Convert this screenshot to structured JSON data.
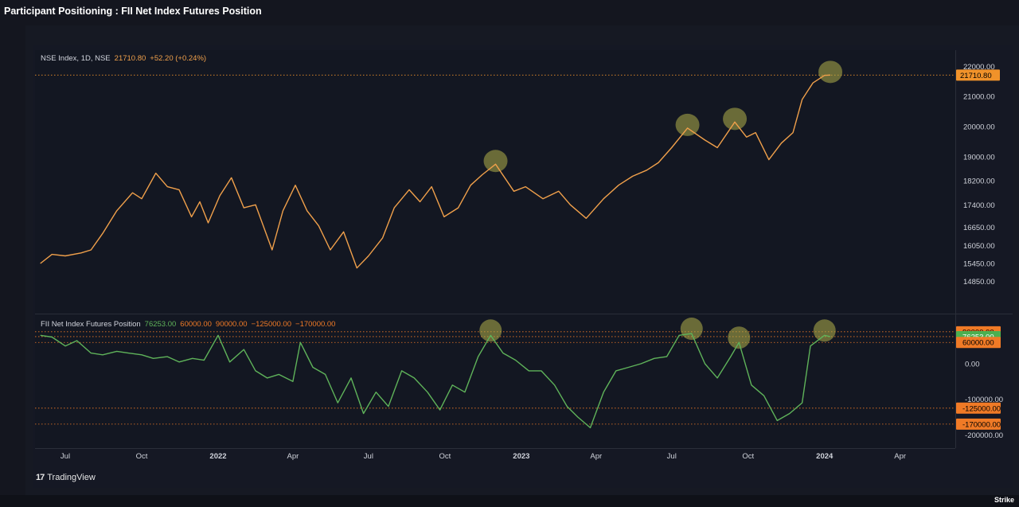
{
  "page": {
    "title": "Participant Positioning : FII Net Index Futures Position",
    "footer_brand": "TradingView",
    "corner_mark": "Strike"
  },
  "colors": {
    "nifty_line": "#f0a04b",
    "fii_line": "#5fb35a",
    "highlight": "#b3b04a",
    "price_tag": "#f0922a",
    "fii_tag": "#4caf50",
    "level_tag": "#f07a26",
    "background": "#131722",
    "text": "#d1d4dc",
    "muted": "#a3a6af"
  },
  "chart_data": [
    {
      "type": "line",
      "legend": {
        "symbol": "NSE Index, 1D, NSE",
        "last": "21710.80",
        "change": "+52.20 (+0.24%)"
      },
      "y_ticks": [
        "22000.00",
        "21000.00",
        "20000.00",
        "19000.00",
        "18200.00",
        "17400.00",
        "16650.00",
        "16050.00",
        "15450.00",
        "14850.00"
      ],
      "y_tick_values": [
        22000,
        21000,
        20000,
        19000,
        18200,
        17400,
        16650,
        16050,
        15450,
        14850
      ],
      "last_value_label": "21710.80",
      "last_value": 21710.8,
      "series": [
        {
          "values": [
            [
              "2021-06-01",
              15450
            ],
            [
              "2021-06-15",
              15750
            ],
            [
              "2021-07-01",
              15700
            ],
            [
              "2021-07-20",
              15800
            ],
            [
              "2021-08-01",
              15900
            ],
            [
              "2021-08-15",
              16450
            ],
            [
              "2021-09-01",
              17200
            ],
            [
              "2021-09-20",
              17800
            ],
            [
              "2021-10-01",
              17600
            ],
            [
              "2021-10-18",
              18450
            ],
            [
              "2021-11-01",
              18000
            ],
            [
              "2021-11-15",
              17900
            ],
            [
              "2021-11-30",
              17000
            ],
            [
              "2021-12-10",
              17500
            ],
            [
              "2021-12-20",
              16800
            ],
            [
              "2022-01-03",
              17700
            ],
            [
              "2022-01-17",
              18300
            ],
            [
              "2022-02-01",
              17300
            ],
            [
              "2022-02-15",
              17400
            ],
            [
              "2022-03-07",
              15900
            ],
            [
              "2022-03-20",
              17200
            ],
            [
              "2022-04-04",
              18050
            ],
            [
              "2022-04-18",
              17200
            ],
            [
              "2022-05-02",
              16700
            ],
            [
              "2022-05-16",
              15900
            ],
            [
              "2022-06-01",
              16500
            ],
            [
              "2022-06-17",
              15300
            ],
            [
              "2022-07-01",
              15700
            ],
            [
              "2022-07-18",
              16300
            ],
            [
              "2022-08-01",
              17300
            ],
            [
              "2022-08-19",
              17900
            ],
            [
              "2022-09-01",
              17500
            ],
            [
              "2022-09-15",
              18000
            ],
            [
              "2022-09-30",
              17000
            ],
            [
              "2022-10-17",
              17300
            ],
            [
              "2022-11-01",
              18050
            ],
            [
              "2022-11-15",
              18400
            ],
            [
              "2022-12-01",
              18750
            ],
            [
              "2022-12-23",
              17850
            ],
            [
              "2023-01-06",
              18000
            ],
            [
              "2023-01-27",
              17600
            ],
            [
              "2023-02-15",
              17850
            ],
            [
              "2023-03-01",
              17400
            ],
            [
              "2023-03-20",
              16950
            ],
            [
              "2023-04-10",
              17600
            ],
            [
              "2023-04-28",
              18050
            ],
            [
              "2023-05-15",
              18350
            ],
            [
              "2023-06-01",
              18550
            ],
            [
              "2023-06-15",
              18800
            ],
            [
              "2023-07-01",
              19300
            ],
            [
              "2023-07-20",
              19950
            ],
            [
              "2023-08-10",
              19550
            ],
            [
              "2023-08-25",
              19300
            ],
            [
              "2023-09-15",
              20150
            ],
            [
              "2023-09-29",
              19650
            ],
            [
              "2023-10-10",
              19800
            ],
            [
              "2023-10-26",
              18900
            ],
            [
              "2023-11-10",
              19450
            ],
            [
              "2023-11-24",
              19800
            ],
            [
              "2023-12-05",
              20900
            ],
            [
              "2023-12-18",
              21450
            ],
            [
              "2024-01-01",
              21700
            ],
            [
              "2024-01-08",
              21710.8
            ]
          ]
        }
      ],
      "highlights": [
        "2022-12-01",
        "2023-07-20",
        "2023-09-15",
        "2024-01-08"
      ]
    },
    {
      "type": "line",
      "legend": {
        "name": "FII Net Index Futures Position",
        "values": [
          "76253.00",
          "60000.00",
          "90000.00",
          "−125000.00",
          "−170000.00"
        ]
      },
      "y_ticks": [
        "-100000.00",
        "-200000.00",
        "0.00"
      ],
      "y_tick_values": [
        -100000,
        -200000,
        0
      ],
      "level_labels": [
        "90000.00",
        "76253.00",
        "60000.00",
        "-125000.00",
        "-170000.00"
      ],
      "level_values": [
        90000,
        76253,
        60000,
        -125000,
        -170000
      ],
      "series": [
        {
          "values": [
            [
              "2021-06-01",
              80000
            ],
            [
              "2021-06-15",
              75000
            ],
            [
              "2021-07-01",
              50000
            ],
            [
              "2021-07-15",
              65000
            ],
            [
              "2021-08-01",
              30000
            ],
            [
              "2021-08-15",
              25000
            ],
            [
              "2021-09-01",
              35000
            ],
            [
              "2021-09-15",
              30000
            ],
            [
              "2021-10-01",
              25000
            ],
            [
              "2021-10-15",
              15000
            ],
            [
              "2021-11-01",
              20000
            ],
            [
              "2021-11-15",
              5000
            ],
            [
              "2021-12-01",
              15000
            ],
            [
              "2021-12-15",
              10000
            ],
            [
              "2022-01-01",
              80000
            ],
            [
              "2022-01-15",
              5000
            ],
            [
              "2022-02-01",
              40000
            ],
            [
              "2022-02-15",
              -20000
            ],
            [
              "2022-03-01",
              -40000
            ],
            [
              "2022-03-15",
              -30000
            ],
            [
              "2022-04-01",
              -50000
            ],
            [
              "2022-04-10",
              60000
            ],
            [
              "2022-04-25",
              -10000
            ],
            [
              "2022-05-10",
              -30000
            ],
            [
              "2022-05-25",
              -110000
            ],
            [
              "2022-06-10",
              -40000
            ],
            [
              "2022-06-25",
              -140000
            ],
            [
              "2022-07-10",
              -80000
            ],
            [
              "2022-07-25",
              -120000
            ],
            [
              "2022-08-10",
              -20000
            ],
            [
              "2022-08-25",
              -40000
            ],
            [
              "2022-09-10",
              -80000
            ],
            [
              "2022-09-25",
              -130000
            ],
            [
              "2022-10-10",
              -60000
            ],
            [
              "2022-10-25",
              -80000
            ],
            [
              "2022-11-10",
              20000
            ],
            [
              "2022-11-25",
              80000
            ],
            [
              "2022-12-10",
              30000
            ],
            [
              "2022-12-25",
              10000
            ],
            [
              "2023-01-10",
              -20000
            ],
            [
              "2023-01-25",
              -20000
            ],
            [
              "2023-02-10",
              -60000
            ],
            [
              "2023-02-25",
              -120000
            ],
            [
              "2023-03-10",
              -150000
            ],
            [
              "2023-03-25",
              -180000
            ],
            [
              "2023-04-10",
              -80000
            ],
            [
              "2023-04-25",
              -20000
            ],
            [
              "2023-05-10",
              -10000
            ],
            [
              "2023-05-25",
              0
            ],
            [
              "2023-06-10",
              15000
            ],
            [
              "2023-06-25",
              20000
            ],
            [
              "2023-07-10",
              80000
            ],
            [
              "2023-07-25",
              85000
            ],
            [
              "2023-08-10",
              0
            ],
            [
              "2023-08-25",
              -40000
            ],
            [
              "2023-09-10",
              20000
            ],
            [
              "2023-09-20",
              60000
            ],
            [
              "2023-10-05",
              -60000
            ],
            [
              "2023-10-20",
              -90000
            ],
            [
              "2023-11-05",
              -160000
            ],
            [
              "2023-11-20",
              -140000
            ],
            [
              "2023-12-05",
              -110000
            ],
            [
              "2023-12-15",
              50000
            ],
            [
              "2024-01-01",
              80000
            ],
            [
              "2024-01-08",
              76253
            ]
          ]
        }
      ],
      "highlights": [
        "2022-11-25",
        "2023-07-25",
        "2023-09-20",
        "2024-01-01"
      ]
    }
  ],
  "x_axis_labels": [
    {
      "label": "Jul",
      "date": "2021-07-01",
      "bold": false
    },
    {
      "label": "Oct",
      "date": "2021-10-01",
      "bold": false
    },
    {
      "label": "2022",
      "date": "2022-01-01",
      "bold": true
    },
    {
      "label": "Apr",
      "date": "2022-04-01",
      "bold": false
    },
    {
      "label": "Jul",
      "date": "2022-07-01",
      "bold": false
    },
    {
      "label": "Oct",
      "date": "2022-10-01",
      "bold": false
    },
    {
      "label": "2023",
      "date": "2023-01-01",
      "bold": true
    },
    {
      "label": "Apr",
      "date": "2023-04-01",
      "bold": false
    },
    {
      "label": "Jul",
      "date": "2023-07-01",
      "bold": false
    },
    {
      "label": "Oct",
      "date": "2023-10-01",
      "bold": false
    },
    {
      "label": "2024",
      "date": "2024-01-01",
      "bold": true
    },
    {
      "label": "Apr",
      "date": "2024-04-01",
      "bold": false
    }
  ]
}
